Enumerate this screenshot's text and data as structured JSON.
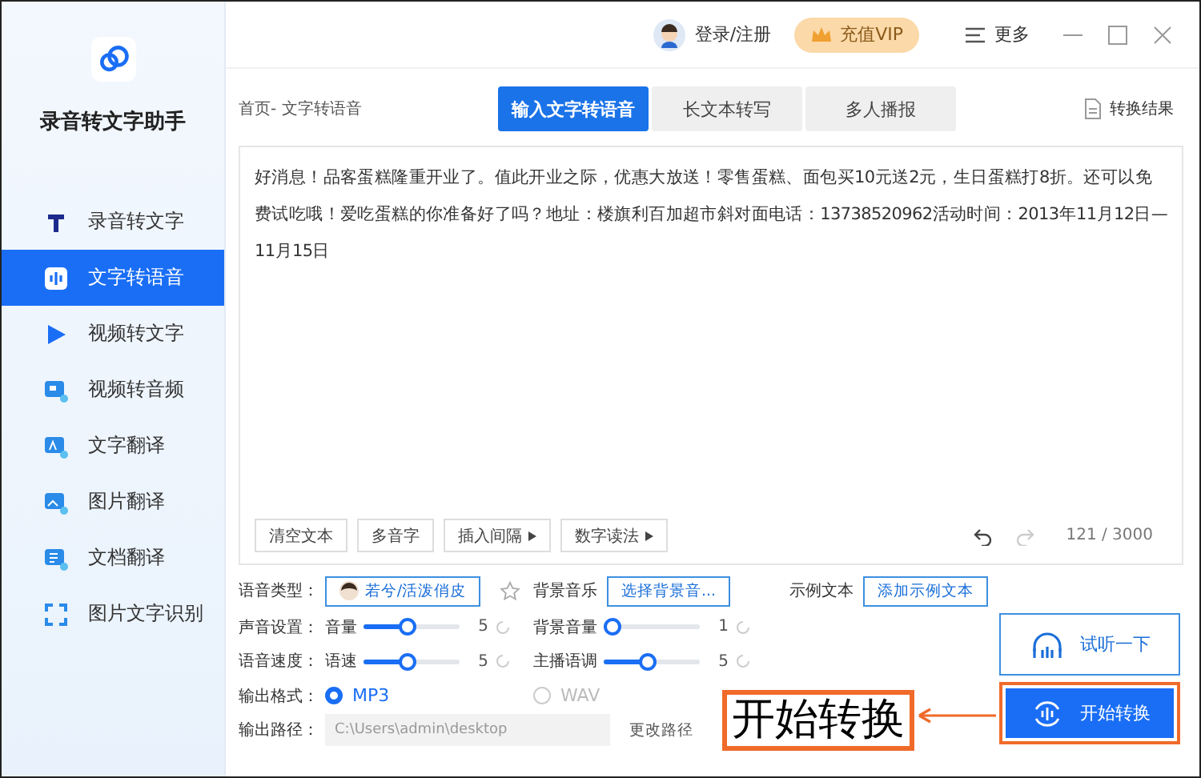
{
  "app": {
    "name": "录音转文字助手"
  },
  "sidebar": {
    "items": [
      {
        "label": "录音转文字",
        "kind": "text",
        "selected": false
      },
      {
        "label": "文字转语音",
        "kind": "audio",
        "selected": true
      },
      {
        "label": "视频转文字",
        "kind": "video",
        "selected": false
      },
      {
        "label": "视频转音频",
        "kind": "media",
        "selected": false
      },
      {
        "label": "文字翻译",
        "kind": "translate",
        "selected": false
      },
      {
        "label": "图片翻译",
        "kind": "image",
        "selected": false
      },
      {
        "label": "文档翻译",
        "kind": "document",
        "selected": false
      },
      {
        "label": "图片文字识别",
        "kind": "scan",
        "selected": false
      }
    ]
  },
  "top_bar": {
    "login": "登录/注册",
    "vip": "充值VIP",
    "more": "更多"
  },
  "breadcrumb": "首页- 文字转语音",
  "tabs": [
    {
      "label": "输入文字转语音",
      "selected": true
    },
    {
      "label": "长文本转写",
      "selected": false
    },
    {
      "label": "多人播报",
      "selected": false
    }
  ],
  "result_link": "转换结果",
  "editor": {
    "text": "好消息！品客蛋糕隆重开业了。值此开业之际，优惠大放送！零售蛋糕、面包买10元送2元，生日蛋糕打8折。还可以免费试吃哦！爱吃蛋糕的你准备好了吗？地址：楼旗利百加超市斜对面电话：13738520962活动时间：2013年11月12日—11月15日",
    "tools": [
      {
        "label": "清空文本",
        "kind": "plain"
      },
      {
        "label": "多音字",
        "kind": "plain"
      },
      {
        "label": "插入间隔",
        "kind": "menu"
      },
      {
        "label": "数字读法",
        "kind": "menu"
      }
    ],
    "undo": {
      "disabled": false
    },
    "redo": {
      "disabled": true
    },
    "counter": "121 / 3000"
  },
  "settings": {
    "voice": {
      "label": "语音类型：",
      "value": "若兮/活泼俏皮",
      "favorite": false
    },
    "background_music": {
      "label": "背景音乐",
      "button": "选择背景音..."
    },
    "sample_text": {
      "label": "示例文本",
      "button": "添加示例文本"
    },
    "rows": [
      {
        "label": "声音设置：",
        "controls": [
          {
            "name": "音量",
            "level": 0.45,
            "reading": "5"
          },
          {
            "name": "背景音量",
            "level": 0,
            "reading": "1"
          }
        ]
      },
      {
        "label": "语音速度：",
        "controls": [
          {
            "name": "语速",
            "level": 0.45,
            "reading": "5"
          },
          {
            "name": "主播语调",
            "level": 0.45,
            "reading": "5"
          }
        ]
      }
    ],
    "format": {
      "label": "输出格式：",
      "options": [
        {
          "label": "MP3",
          "selected": true
        },
        {
          "label": "WAV",
          "selected": false
        }
      ]
    },
    "path": {
      "label": "输出路径：",
      "value": "C:\\Users\\admin\\desktop",
      "change": "更改路径"
    }
  },
  "actions": [
    {
      "label": "试听一下",
      "kind": "preview",
      "highlighted": false
    },
    {
      "label": "开始转换",
      "kind": "start",
      "highlighted": true
    }
  ],
  "annotation": {
    "text": "开始转换"
  }
}
